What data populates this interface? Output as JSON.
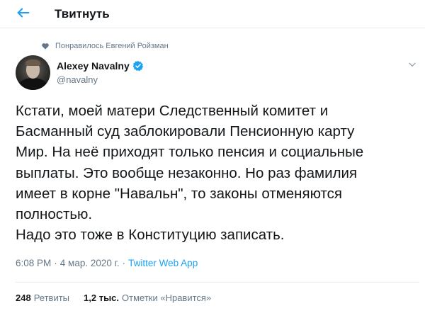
{
  "header": {
    "title": "Твитнуть"
  },
  "social_context": {
    "liked_by": "Понравилось Евгений Ройзман"
  },
  "author": {
    "name": "Alexey Navalny",
    "handle": "@navalny"
  },
  "tweet": {
    "lines": [
      "Кстати, моей матери Следственный комитет и",
      "Басманный суд заблокировали Пенсионную карту",
      "Мир. На неё приходят только пенсия и социальные",
      "выплаты. Это вообще незаконно. Но раз фамилия",
      "имеет в корне \"Навальн\", то законы отменяются",
      "полностью.",
      "Надо это тоже в Конституцию записать."
    ],
    "time": "6:08 PM",
    "date": "4 мар. 2020 г.",
    "separator": "·",
    "source": "Twitter Web App"
  },
  "stats": {
    "retweets_count": "248",
    "retweets_label": "Ретвиты",
    "likes_count": "1,2 тыс.",
    "likes_label": "Отметки «Нравится»"
  },
  "colors": {
    "accent": "#1da1f2",
    "muted": "#657786",
    "text": "#14171a",
    "divider": "#e6ecf0"
  },
  "icons": {
    "back": "arrow-left-icon",
    "liked": "heart-icon",
    "verified": "verified-badge-icon",
    "more": "chevron-down-icon"
  }
}
